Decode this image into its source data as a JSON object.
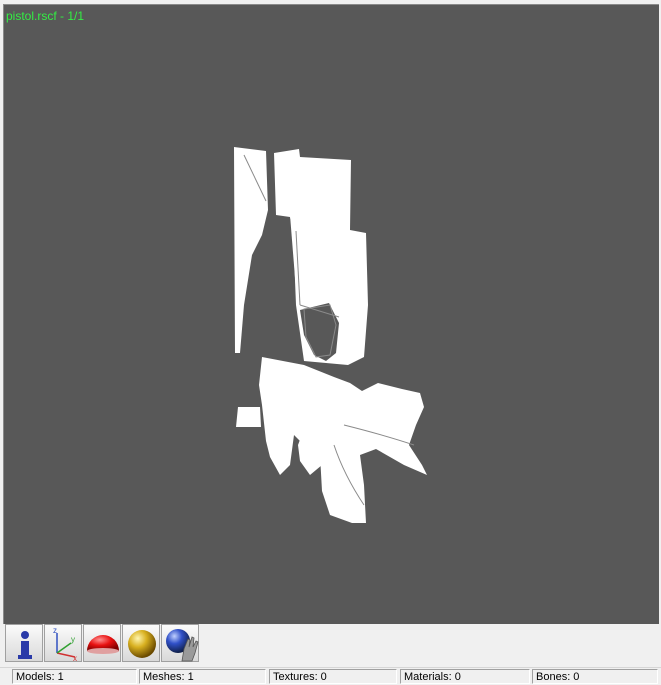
{
  "viewport": {
    "title": "pistol.rscf - 1/1",
    "background": "#585858",
    "title_color": "#33ee44"
  },
  "toolbar": {
    "buttons": [
      {
        "icon": "info-icon"
      },
      {
        "icon": "axes-icon"
      },
      {
        "icon": "red-hemisphere-icon"
      },
      {
        "icon": "gold-sphere-icon"
      },
      {
        "icon": "blue-sphere-hand-icon"
      }
    ]
  },
  "statusbar": {
    "models": "Models: 1",
    "meshes": "Meshes: 1",
    "textures": "Textures: 0",
    "materials": "Materials: 0",
    "bones": "Bones: 0"
  }
}
